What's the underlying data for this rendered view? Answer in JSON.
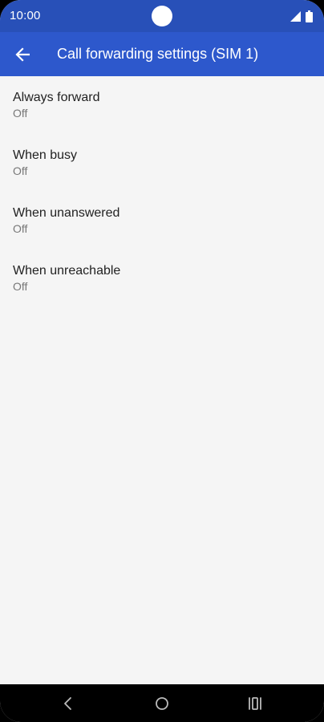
{
  "status_bar": {
    "time": "10:00",
    "icons": [
      "cellular-signal-icon",
      "battery-icon"
    ]
  },
  "app_bar": {
    "title": "Call forwarding settings (SIM 1)",
    "back_icon": "arrow-left-icon"
  },
  "settings": [
    {
      "title": "Always forward",
      "value": "Off"
    },
    {
      "title": "When busy",
      "value": "Off"
    },
    {
      "title": "When unanswered",
      "value": "Off"
    },
    {
      "title": "When unreachable",
      "value": "Off"
    }
  ],
  "nav_bar": {
    "icons": [
      "nav-back-icon",
      "nav-home-icon",
      "nav-recents-icon"
    ]
  },
  "colors": {
    "status_bar": "#2850b8",
    "app_bar": "#2d58cc",
    "background": "#f5f5f5"
  }
}
